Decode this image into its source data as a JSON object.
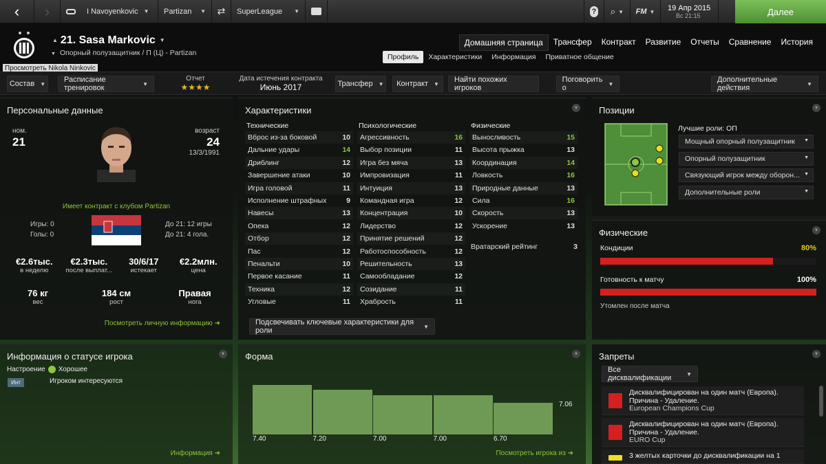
{
  "topbar": {
    "manager": "I Navoyenkovic",
    "club": "Partizan",
    "league": "SuperLeague",
    "game": "FM",
    "date": "19 Апр 2015",
    "time": "Вс 21:15",
    "continue": "Далее"
  },
  "player": {
    "title": "21. Sasa Markovic",
    "subtitle": "Опорный полузащитник / П (Ц) - Partizan",
    "tooltip": "Просмотреть Nikola Ninkovic"
  },
  "nav": {
    "main": [
      "Домашняя страница",
      "Трансфер",
      "Контракт",
      "Развитие",
      "Отчеты",
      "Сравнение",
      "История"
    ],
    "sub": [
      "Профиль",
      "Характеристики",
      "Информация",
      "Приватное общение"
    ]
  },
  "toolbar": {
    "squad": "Состав",
    "training": "Расписание тренировок",
    "report_label": "Отчет",
    "stars": "★★★★",
    "contract_label": "Дата истечения контракта",
    "contract_value": "Июнь 2017",
    "transfer": "Трансфер",
    "contract": "Контракт",
    "similar": "Найти похожих игроков",
    "talk": "Поговорить о",
    "more": "Дополнительные действия"
  },
  "personal": {
    "title": "Персональные данные",
    "num_label": "ном.",
    "num": "21",
    "age_label": "возраст",
    "age": "24",
    "dob": "13/3/1991",
    "contract_note": "Имеет контракт с клубом Partizan",
    "games": "Игры: 0",
    "goals": "Голы: 0",
    "u21_games": "До 21: 12 игры",
    "u21_goals": "До 21: 4 гола.",
    "stats": [
      {
        "v": "€2.6тыс.",
        "l": "в неделю"
      },
      {
        "v": "€2.3тыс.",
        "l": "после выплат..."
      },
      {
        "v": "30/6/17",
        "l": "истекает"
      },
      {
        "v": "€2.2млн.",
        "l": "цена"
      }
    ],
    "body": [
      {
        "v": "76 кг",
        "l": "вес"
      },
      {
        "v": "184 см",
        "l": "рост"
      },
      {
        "v": "Правая",
        "l": "нога"
      }
    ],
    "link": "Посмотреть личную информацию"
  },
  "attributes": {
    "title": "Характеристики",
    "groups": [
      {
        "name": "Технические",
        "items": [
          [
            "Вброс из-за боковой",
            "10"
          ],
          [
            "Дальние удары",
            "14"
          ],
          [
            "Дриблинг",
            "12"
          ],
          [
            "Завершение атаки",
            "10"
          ],
          [
            "Игра головой",
            "11"
          ],
          [
            "Исполнение штрафных",
            "9"
          ],
          [
            "Навесы",
            "13"
          ],
          [
            "Опека",
            "12"
          ],
          [
            "Отбор",
            "12"
          ],
          [
            "Пас",
            "12"
          ],
          [
            "Пенальти",
            "10"
          ],
          [
            "Первое касание",
            "11"
          ],
          [
            "Техника",
            "12"
          ],
          [
            "Угловые",
            "11"
          ]
        ]
      },
      {
        "name": "Психологические",
        "items": [
          [
            "Агрессивность",
            "16"
          ],
          [
            "Выбор позиции",
            "11"
          ],
          [
            "Игра без мяча",
            "13"
          ],
          [
            "Импровизация",
            "11"
          ],
          [
            "Интуиция",
            "13"
          ],
          [
            "Командная игра",
            "12"
          ],
          [
            "Концентрация",
            "10"
          ],
          [
            "Лидерство",
            "12"
          ],
          [
            "Принятие решений",
            "12"
          ],
          [
            "Работоспособность",
            "12"
          ],
          [
            "Решительность",
            "13"
          ],
          [
            "Самообладание",
            "12"
          ],
          [
            "Созидание",
            "11"
          ],
          [
            "Храбрость",
            "11"
          ]
        ]
      },
      {
        "name": "Физические",
        "items": [
          [
            "Выносливость",
            "15"
          ],
          [
            "Высота прыжка",
            "13"
          ],
          [
            "Координация",
            "14"
          ],
          [
            "Ловкость",
            "16"
          ],
          [
            "Природные данные",
            "13"
          ],
          [
            "Сила",
            "16"
          ],
          [
            "Скорость",
            "13"
          ],
          [
            "Ускорение",
            "13"
          ]
        ]
      }
    ],
    "gk_label": "Вратарский рейтинг",
    "gk_value": "3",
    "highlight": "Подсвечивать ключевые характеристики для роли"
  },
  "positions": {
    "title": "Позиции",
    "best": "Лучшие роли: ОП",
    "roles": [
      "Мощный опорный полузащитник",
      "Опорный полузащитник",
      "Связующий игрок между оборон...",
      "Дополнительные роли"
    ]
  },
  "physical": {
    "title": "Физические",
    "condition_label": "Кондиции",
    "condition": "80%",
    "condition_value": 0.8,
    "readiness_label": "Готовность к матчу",
    "readiness": "100%",
    "readiness_value": 1.0,
    "note": "Утомлен после матча"
  },
  "status": {
    "title": "Информация о статусе игрока",
    "mood_label": "Настроение",
    "mood": "Хорошее",
    "badge": "Инт",
    "interest": "Игроком интересуются",
    "link": "Информация"
  },
  "form": {
    "title": "Форма",
    "ratings": [
      "7.40",
      "7.20",
      "7.00",
      "7.00",
      "6.70"
    ],
    "average": "7.06",
    "link": "Посмотреть игрока из"
  },
  "bans": {
    "title": "Запреты",
    "filter": "Все дисквалификации",
    "items": [
      {
        "text": "Дисквалифицирован на один матч (Европа). Причина - Удаление.",
        "comp": "European Champions Cup",
        "color": "#d42020"
      },
      {
        "text": "Дисквалифицирован на один матч (Европа). Причина - Удаление.",
        "comp": "EURO Cup",
        "color": "#d42020"
      },
      {
        "text": "3 желтых карточки до дисквалификации на 1",
        "comp": "",
        "color": "#f0e020"
      }
    ]
  },
  "colors": {
    "accent": "#8dc63f",
    "bar": "#d42020",
    "form_bar": "#6f9a55",
    "yellow": "#e2c81c"
  }
}
